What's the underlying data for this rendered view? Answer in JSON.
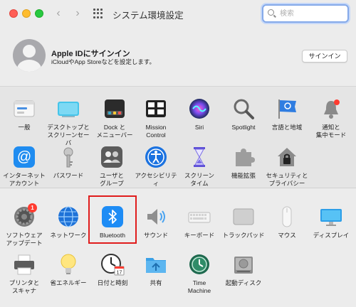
{
  "window": {
    "title": "システム環境設定",
    "nav_back": "‹",
    "nav_forward": "›"
  },
  "search": {
    "placeholder": "検索",
    "value": ""
  },
  "account": {
    "title": "Apple IDにサインイン",
    "subtitle": "iCloudやApp Storeなどを設定します。",
    "signin_label": "サインイン"
  },
  "section1": [
    {
      "label": "一般",
      "icon": "general-icon"
    },
    {
      "label": "デスクトップと\nスクリーンセーバ",
      "icon": "desktop-icon"
    },
    {
      "label": "Dock と\nメニューバー",
      "icon": "dock-icon"
    },
    {
      "label": "Mission\nControl",
      "icon": "mission-control-icon"
    },
    {
      "label": "Siri",
      "icon": "siri-icon"
    },
    {
      "label": "Spotlight",
      "icon": "spotlight-icon"
    },
    {
      "label": "言語と地域",
      "icon": "language-icon"
    },
    {
      "label": "通知と\n集中モード",
      "icon": "notifications-icon"
    },
    {
      "label": "インターネット\nアカウント",
      "icon": "internet-accounts-icon"
    },
    {
      "label": "パスワード",
      "icon": "key-icon"
    },
    {
      "label": "ユーザと\nグループ",
      "icon": "users-icon"
    },
    {
      "label": "アクセシビリティ",
      "icon": "accessibility-icon"
    },
    {
      "label": "スクリーン\nタイム",
      "icon": "hourglass-icon"
    },
    {
      "label": "機能拡張",
      "icon": "puzzle-icon"
    },
    {
      "label": "セキュリティと\nプライバシー",
      "icon": "house-lock-icon"
    }
  ],
  "section2": [
    {
      "label": "ソフトウェア\nアップデート",
      "icon": "gear-icon",
      "badge": "1"
    },
    {
      "label": "ネットワーク",
      "icon": "globe-icon"
    },
    {
      "label": "Bluetooth",
      "icon": "bluetooth-icon"
    },
    {
      "label": "サウンド",
      "icon": "speaker-icon"
    },
    {
      "label": "キーボード",
      "icon": "keyboard-icon"
    },
    {
      "label": "トラックパッド",
      "icon": "trackpad-icon"
    },
    {
      "label": "マウス",
      "icon": "mouse-icon"
    },
    {
      "label": "ディスプレイ",
      "icon": "display-icon"
    },
    {
      "label": "プリンタと\nスキャナ",
      "icon": "printer-icon"
    },
    {
      "label": "省エネルギー",
      "icon": "lightbulb-icon"
    },
    {
      "label": "日付と時刻",
      "icon": "clock-icon"
    },
    {
      "label": "共有",
      "icon": "folder-icon"
    },
    {
      "label": "Time\nMachine",
      "icon": "time-machine-icon"
    },
    {
      "label": "起動ディスク",
      "icon": "disk-icon"
    }
  ],
  "selected": "Bluetooth",
  "colors": {
    "highlight": "#e01c1c",
    "search_focus": "#84a9e9",
    "bluetooth": "#1e8cf5"
  }
}
